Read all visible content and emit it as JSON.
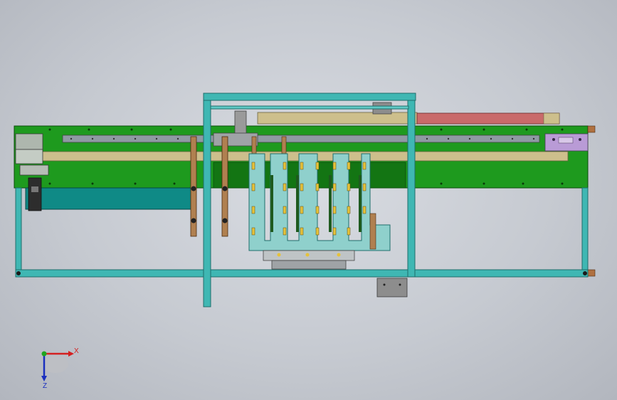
{
  "triad": {
    "x_label": "X",
    "z_label": "Z",
    "x_color": "#d42020",
    "z_color": "#1a2fbf",
    "y_color": "#1fa51f"
  },
  "colors": {
    "frame": "#3fb7b3",
    "frame_dark": "#1f6e6b",
    "plate": "#1e9a1e",
    "plate_dark": "#137513",
    "rail": "#8f9aa3",
    "wood": "#cdbf8c",
    "bronze": "#b08050",
    "teal_block": "#0f8a86",
    "pink": "#c96a6a",
    "lavender": "#b99bd6",
    "gray_box": "#8d8d8d",
    "light_teal": "#8fd0cc",
    "yellow_pad": "#e6c23a"
  }
}
